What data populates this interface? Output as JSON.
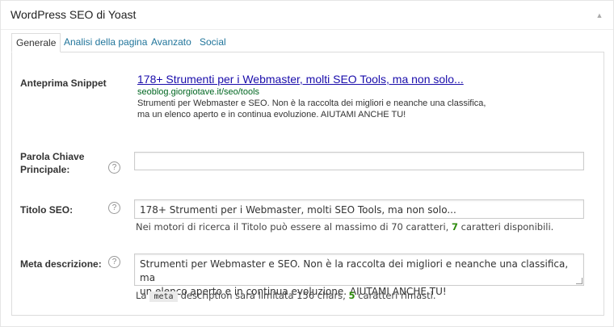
{
  "metabox": {
    "title": "WordPress SEO di Yoast",
    "toggle_icon": "triangle-up"
  },
  "tabs": [
    {
      "label": "Generale",
      "active": true
    },
    {
      "label": "Analisi della pagina",
      "active": false
    },
    {
      "label": "Avanzato",
      "active": false
    },
    {
      "label": "Social",
      "active": false
    }
  ],
  "snippet": {
    "label": "Anteprima Snippet",
    "title": "178+ Strumenti per i Webmaster, molti SEO Tools, ma non solo...",
    "url": "seoblog.giorgiotave.it/seo/tools",
    "description_line1": "Strumenti per Webmaster e SEO. Non è la raccolta dei migliori e neanche una classifica,",
    "description_line2": "ma un elenco aperto e in continua evoluzione. AIUTAMI ANCHE TU!"
  },
  "focus_keyword": {
    "label_line1": "Parola Chiave",
    "label_line2": "Principale:",
    "value": "",
    "help": "?"
  },
  "seo_title": {
    "label": "Titolo SEO:",
    "value": "178+ Strumenti per i Webmaster, molti SEO Tools, ma non solo...",
    "help": "?",
    "hint_before": "Nei motori di ricerca il Titolo può essere al massimo di 70 caratteri,",
    "hint_count": "7",
    "hint_after": "caratteri disponibili."
  },
  "meta_description": {
    "label": "Meta descrizione:",
    "value_line1": "Strumenti per Webmaster e SEO. Non è la raccolta dei migliori e neanche una classifica, ma",
    "value_line2": "un elenco aperto e in continua evoluzione. AIUTAMI ANCHE TU!",
    "help": "?",
    "hint_la": "La",
    "hint_code": "meta",
    "hint_middle": "description sarà limitata 156 chars,",
    "hint_count": "5",
    "hint_after": "caratteri rimasti."
  },
  "colors": {
    "link": "#21759b",
    "snippet_title": "#1a0dab",
    "snippet_url": "#006621",
    "good_count": "#2e8b0c"
  }
}
